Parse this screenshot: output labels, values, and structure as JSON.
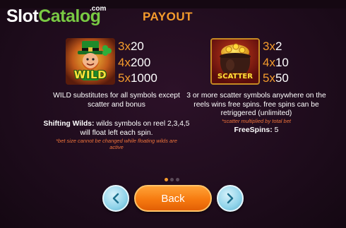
{
  "brand": {
    "slot": "Slot",
    "catalog": "Catalog",
    "com": ".com"
  },
  "title": "PAYOUT",
  "wild": {
    "image_label": "WILD",
    "payouts": [
      {
        "mult": "3x",
        "value": "20"
      },
      {
        "mult": "4x",
        "value": "200"
      },
      {
        "mult": "5x",
        "value": "1000"
      }
    ],
    "description": "WILD substitutes for all symbols except scatter and bonus"
  },
  "scatter": {
    "image_label": "SCATTER",
    "payouts": [
      {
        "mult": "3x",
        "value": "2"
      },
      {
        "mult": "4x",
        "value": "10"
      },
      {
        "mult": "5x",
        "value": "50"
      }
    ],
    "description": "3 or more scatter symbols anywhere on the reels wins free spins. free spins can be retriggered (unlimited)",
    "note": "*scatter multiplied by total bet",
    "freespins_label": "FreeSpins:",
    "freespins_value": "5"
  },
  "shifting": {
    "label": "Shifting Wilds:",
    "text": "wilds symbols on reel 2,3,4,5 will float left each spin.",
    "note": "*bet size cannot be changed while floating wilds are active"
  },
  "pagination": {
    "total": 3,
    "active": 0
  },
  "buttons": {
    "back": "Back",
    "prev_icon": "chevron-left-icon",
    "next_icon": "chevron-right-icon"
  },
  "colors": {
    "accent": "#f49b2c",
    "note": "#f0733a",
    "brand_green": "#79c943",
    "nav": "#8fd3ea"
  }
}
